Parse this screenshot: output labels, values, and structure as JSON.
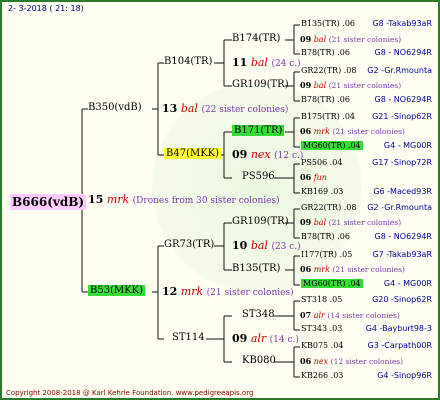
{
  "date": "2-  3-2018 ( 21: 18)",
  "copyright": "Copyright 2008-2018 @ Karl Kehrle Foundation.   www.pedigreeapis.org",
  "root": {
    "name": "B666(vdB)",
    "num": "15",
    "race": "mrk",
    "sisters": "(Drones from 30 sister colonies)"
  },
  "sire": {
    "name": "B350(vdB)",
    "num": "13",
    "race": "bal",
    "sisters": "(22 sister colonies)"
  },
  "dam": {
    "name": "B53(MKK)",
    "num": "12",
    "race": "mrk",
    "sisters": "(21 sister colonies)"
  },
  "ss": {
    "name": "B104(TR)",
    "num": "11",
    "race": "bal",
    "sisters": "(24 c.)"
  },
  "sd": {
    "name": "B47(MKK)",
    "num": "09",
    "race": "nex",
    "sisters": "(12 c.)"
  },
  "ds": {
    "name": "GR73(TR)",
    "num": "10",
    "race": "bal",
    "sisters": "(23 c.)"
  },
  "dd": {
    "name": "ST114",
    "num": "09",
    "race": "alr",
    "sisters": "(14 c.)"
  },
  "g3": [
    {
      "name": "B174(TR)",
      "num": "09",
      "race": "bal",
      "sisters": "(21 sister colonies)"
    },
    {
      "name": "GR109(TR)",
      "num": "09",
      "race": "bal",
      "sisters": "(21 sister colonies)"
    },
    {
      "name": "B171(TR)",
      "num": "06",
      "race": "mrk",
      "sisters": "(21 sister colonies)"
    },
    {
      "name": "PS596",
      "num": "06",
      "race": "fun",
      "sisters": ""
    },
    {
      "name": "GR109(TR)",
      "num": "09",
      "race": "bal",
      "sisters": "(21 sister colonies)"
    },
    {
      "name": "B135(TR)",
      "num": "06",
      "race": "mrk",
      "sisters": "(21 sister colonies)"
    },
    {
      "name": "ST348",
      "num": "07",
      "race": "alr",
      "sisters": "(14 sister colonies)"
    },
    {
      "name": "KB080",
      "num": "06",
      "race": "nex",
      "sisters": "(12 sister colonies)"
    }
  ],
  "g4": [
    {
      "left": "B135(TR) .06",
      "right": "G8 -Takab93aR"
    },
    {
      "left": "B78(TR) .06",
      "right": "G8 - NO6294R"
    },
    {
      "left": "GR22(TR) .08",
      "right": "G2 -Gr.Rmounta"
    },
    {
      "left": "B78(TR) .06",
      "right": "G8 - NO6294R"
    },
    {
      "left": "B175(TR) .04",
      "right": "G21 -Sinop62R"
    },
    {
      "left": "MG60(TR) .04",
      "right": "G4 - MG00R"
    },
    {
      "left": "PS506 .04",
      "right": "G17 -Sinop72R"
    },
    {
      "left": "KB169 .03",
      "right": "G6 -Maced93R"
    },
    {
      "left": "GR22(TR) .08",
      "right": "G2 -Gr.Rmounta"
    },
    {
      "left": "B78(TR) .06",
      "right": "G8 - NO6294R"
    },
    {
      "left": "I177(TR) .05",
      "right": "G7 -Takab93aR"
    },
    {
      "left": "MG60(TR) .04",
      "right": "G4 - MG00R"
    },
    {
      "left": "ST318 .05",
      "right": "G20 -Sinop62R"
    },
    {
      "left": "ST343 .03",
      "right": "G4 -Bayburt98-3"
    },
    {
      "left": "KB075 .04",
      "right": "G3 -Carpath00R"
    },
    {
      "left": "KB266 .03",
      "right": "G4 -Sinop96R"
    }
  ]
}
